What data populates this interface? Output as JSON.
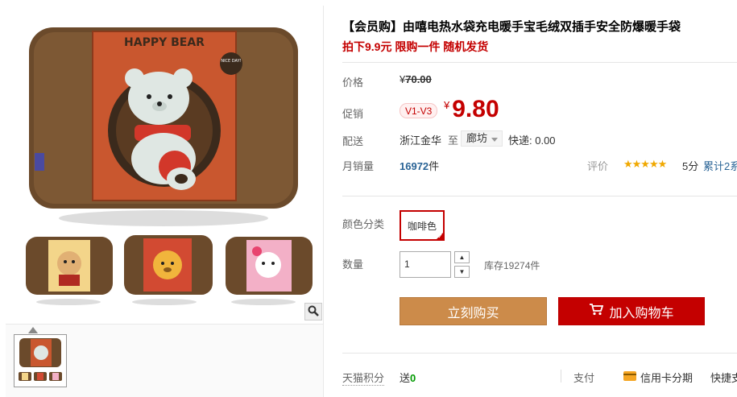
{
  "product": {
    "title": "【会员购】由嘻电热水袋充电暖手宝毛绒双插手安全防爆暖手袋",
    "subtitle": "拍下9.9元 限购一件 随机发货"
  },
  "price": {
    "label": "价格",
    "currency": "¥",
    "original": "70.00"
  },
  "promo": {
    "label": "促销",
    "tag": "V1-V3",
    "currency": "¥",
    "price": "9.80"
  },
  "delivery": {
    "label": "配送",
    "from": "浙江金华",
    "to_word": "至",
    "destination": "廊坊",
    "express": "快递: 0.00"
  },
  "sales": {
    "label": "月销量",
    "count": "16972",
    "unit": "件",
    "rating_label": "评价",
    "stars": "★★★★★",
    "score": "5分",
    "cumulative": "累计2系"
  },
  "options": {
    "color_label": "颜色分类",
    "color_value": "咖啡色",
    "qty_label": "数量",
    "qty_value": "1",
    "stock": "库存19274件"
  },
  "actions": {
    "buy_now": "立刻购买",
    "add_cart": "加入购物车"
  },
  "footer": {
    "points_label": "天猫积分",
    "points_prefix": "送",
    "points_value": "0",
    "pay_label": "支付",
    "credit_installment": "信用卡分期",
    "quick": "快捷支"
  },
  "image": {
    "brand_text": "HAPPY BEAR",
    "badge_text": "NICE DAY!"
  },
  "colors": {
    "accent_red": "#c40000",
    "buy_orange": "#cc8b4a",
    "fur_brown": "#6b4a2b",
    "link_blue": "#2a6496",
    "star_gold": "#f0a800"
  }
}
